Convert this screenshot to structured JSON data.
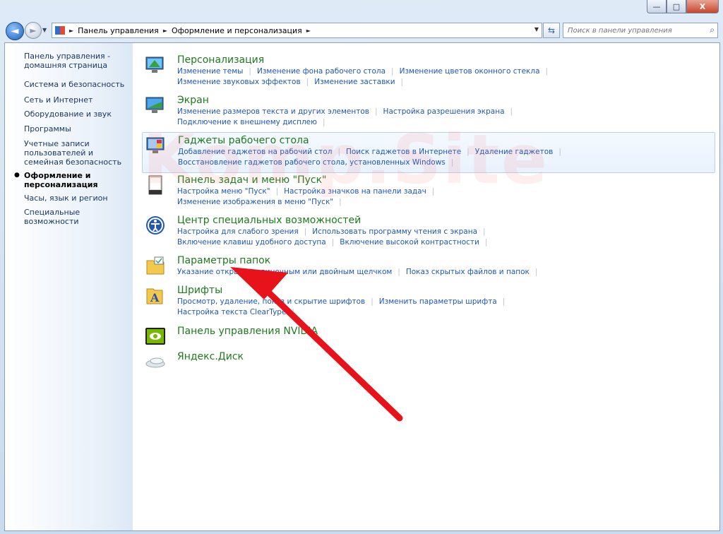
{
  "titlebar": {
    "background_text": "",
    "buttons": {
      "minimize": "—",
      "maximize": "□",
      "close": "X"
    }
  },
  "nav": {
    "back_glyph": "◄",
    "forward_glyph": "►",
    "breadcrumbs": [
      "Панель управления",
      "Оформление и персонализация"
    ],
    "search_placeholder": "Поиск в панели управления"
  },
  "sidebar": {
    "items": [
      {
        "label": "Панель управления - домашняя страница",
        "current": false
      },
      {
        "label": "Система и безопасность",
        "current": false
      },
      {
        "label": "Сеть и Интернет",
        "current": false
      },
      {
        "label": "Оборудование и звук",
        "current": false
      },
      {
        "label": "Программы",
        "current": false
      },
      {
        "label": "Учетные записи пользователей и семейная безопасность",
        "current": false
      },
      {
        "label": "Оформление и персонализация",
        "current": true
      },
      {
        "label": "Часы, язык и регион",
        "current": false
      },
      {
        "label": "Специальные возможности",
        "current": false
      }
    ],
    "bullet": "●"
  },
  "categories": [
    {
      "title": "Персонализация",
      "icon": "personalization-icon",
      "links": [
        [
          "Изменение темы",
          "Изменение фона рабочего стола",
          "Изменение цветов оконного стекла"
        ],
        [
          "Изменение звуковых эффектов",
          "Изменение заставки"
        ]
      ]
    },
    {
      "title": "Экран",
      "icon": "display-icon",
      "links": [
        [
          "Изменение размеров текста и других элементов",
          "Настройка разрешения экрана"
        ],
        [
          "Подключение к внешнему дисплею"
        ]
      ]
    },
    {
      "title": "Гаджеты рабочего стола",
      "icon": "gadgets-icon",
      "links": [
        [
          "Добавление гаджетов на рабочий стол",
          "Поиск гаджетов в Интернете",
          "Удаление гаджетов"
        ],
        [
          "Восстановление гаджетов рабочего стола, установленных Windows"
        ]
      ]
    },
    {
      "title": "Панель задач и меню \"Пуск\"",
      "icon": "taskbar-icon",
      "links": [
        [
          "Настройка меню \"Пуск\"",
          "Настройка значков на панели задач"
        ],
        [
          "Изменение изображения в меню \"Пуск\""
        ]
      ]
    },
    {
      "title": "Центр специальных возможностей",
      "icon": "ease-of-access-icon",
      "links": [
        [
          "Настройка для слабого зрения",
          "Использовать программу чтения с экрана"
        ],
        [
          "Включение клавиш удобного доступа",
          "Включение высокой контрастности"
        ]
      ]
    },
    {
      "title": "Параметры папок",
      "icon": "folder-options-icon",
      "links": [
        [
          "Указание открытия одиночным или двойным щелчком",
          "Показ скрытых файлов и папок"
        ]
      ]
    },
    {
      "title": "Шрифты",
      "icon": "fonts-icon",
      "links": [
        [
          "Просмотр, удаление, показ и скрытие шрифтов",
          "Изменить параметры шрифта"
        ],
        [
          "Настройка текста ClearType"
        ]
      ]
    },
    {
      "title": "Панель управления NVIDIA",
      "icon": "nvidia-icon",
      "links": []
    },
    {
      "title": "Яндекс.Диск",
      "icon": "yandex-disk-icon",
      "links": []
    }
  ],
  "watermark": "Komp.Site",
  "colors": {
    "link": "#1f57b7",
    "category_title": "#1e7b1e",
    "arrow": "#e8121a"
  }
}
